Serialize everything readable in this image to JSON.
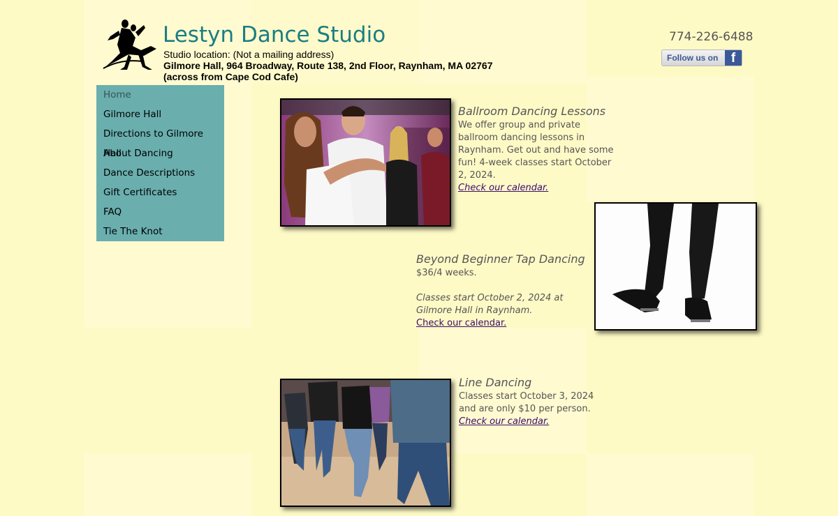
{
  "header": {
    "title": "Lestyn Dance Studio",
    "location_label": "Studio location: (Not a mailing address)",
    "address": "Gilmore Hall, 964 Broadway, Route 138, 2nd Floor, Raynham, MA 02767",
    "landmark": "(across from Cape Cod Cafe)",
    "phone": "774-226-6488",
    "follow_label": "Follow us on",
    "follow_icon": "facebook-f"
  },
  "nav": {
    "items": [
      {
        "label": "Home"
      },
      {
        "label": "Gilmore Hall"
      },
      {
        "label": "Directions to Gilmore Hall"
      },
      {
        "label": "About Dancing"
      },
      {
        "label": "Dance Descriptions"
      },
      {
        "label": "Gift Certificates"
      },
      {
        "label": "FAQ"
      },
      {
        "label": "Tie The Knot"
      }
    ]
  },
  "sections": {
    "ballroom": {
      "title": "Ballroom Dancing Lessons",
      "lines": [
        "We offer group and private",
        "ballroom dancing lessons in",
        "Raynham. Get out and have some",
        "fun! 4-week classes start October",
        "2, 2024."
      ],
      "link": "Check our calendar."
    },
    "tap": {
      "title": "Beyond Beginner Tap Dancing",
      "price": "$36/4 weeks.",
      "note_lines": [
        "Classes start October 2, 2024 at",
        "Gilmore Hall in Raynham."
      ],
      "link": "Check our calendar."
    },
    "line": {
      "title": "Line Dancing",
      "lines": [
        "Classes start October 3, 2024",
        "and are only $10 per person."
      ],
      "link": "Check our calendar."
    }
  },
  "colors": {
    "background": "#fefac6",
    "title": "#1a7e82",
    "nav_bg": "#6aaeae",
    "link": "#3b0b6b"
  }
}
